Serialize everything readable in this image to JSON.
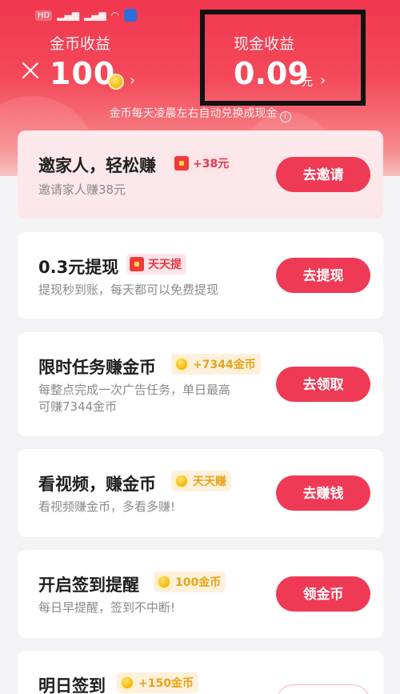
{
  "header": {
    "coins_label": "金币收益",
    "coins_value": "100",
    "cash_label": "现金收益",
    "cash_value": "0.09",
    "cash_unit": "元",
    "exchange_note": "金币每天凌晨左右自动兑换成现金",
    "status_chip": "HD"
  },
  "cards": [
    {
      "title": "邀家人，轻松赚",
      "tag": "+38元",
      "tag_style": "red",
      "tag_icon": "red-packet-icon",
      "desc": "邀请家人赚38元",
      "button": "去邀请"
    },
    {
      "title": "0.3元提现",
      "tag": "天天提",
      "tag_style": "red",
      "tag_icon": "red-packet-icon",
      "desc": "提现秒到账，每天都可以免费提现",
      "button": "去提现"
    },
    {
      "title": "限时任务赚金币",
      "tag": "+7344金币",
      "tag_style": "gold",
      "tag_icon": "coin-icon",
      "desc_line1": "每整点完成一次广告任务，单日最高",
      "desc_line2": "可赚7344金币",
      "button": "去领取"
    },
    {
      "title": "看视频，赚金币",
      "tag": "天天赚",
      "tag_style": "gold",
      "tag_icon": "coin-icon",
      "desc": "看视频赚金币，多看多赚!",
      "button": "去赚钱"
    },
    {
      "title": "开启签到提醒",
      "tag": "100金币",
      "tag_style": "gold",
      "tag_icon": "coin-icon",
      "desc": "每日早提醒，签到不中断!",
      "button": "领金币"
    },
    {
      "title": "明日签到",
      "tag": "+150金币",
      "tag_style": "gold",
      "tag_icon": "coin-icon"
    }
  ],
  "colors": {
    "accent": "#ef3a55",
    "header_top": "#f0374f",
    "gold_text": "#e8a317"
  }
}
